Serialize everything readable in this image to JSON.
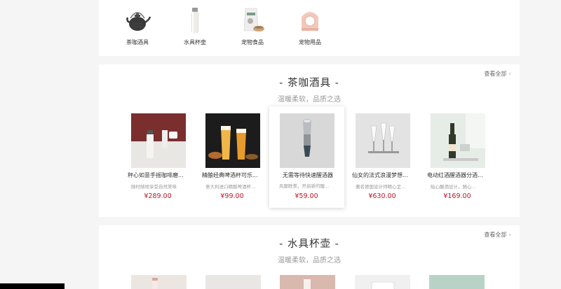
{
  "categories": [
    {
      "label": "茶咖酒具",
      "icon": "teapot-icon"
    },
    {
      "label": "水具杯壶",
      "icon": "thermos-icon"
    },
    {
      "label": "宠物食品",
      "icon": "pet-food-icon"
    },
    {
      "label": "宠物用品",
      "icon": "pet-carrier-icon"
    }
  ],
  "tea_section": {
    "title": "- 茶咖酒具 -",
    "subtitle": "温暖柔软，品质之选",
    "view_all": "查看全部",
    "products": [
      {
        "name": "秤心如意手摇咖啡磨...",
        "desc": "随时随地享受自然美味",
        "price": "¥289.00"
      },
      {
        "name": "精酿经典啤酒杯可乐...",
        "desc": "意大利进口精酿啤酒杯...",
        "price": "¥99.00"
      },
      {
        "name": "无需等待快速醒酒器",
        "desc": "风靡欧美，开启新的醒...",
        "price": "¥59.00"
      },
      {
        "name": "仙女的法式浪漫梦想...",
        "desc": "著名德国设计师精心呈...",
        "price": "¥630.00"
      },
      {
        "name": "电动红酒醒酒器分酒...",
        "desc": "贴心醒酒设计，随心...",
        "price": "¥169.00"
      }
    ]
  },
  "water_section": {
    "title": "- 水具杯壶 -",
    "subtitle": "温暖柔软，品质之选",
    "view_all": "查看全部"
  },
  "colors": {
    "price": "#c81623",
    "background": "#f5f5f5",
    "panel": "#ffffff"
  }
}
